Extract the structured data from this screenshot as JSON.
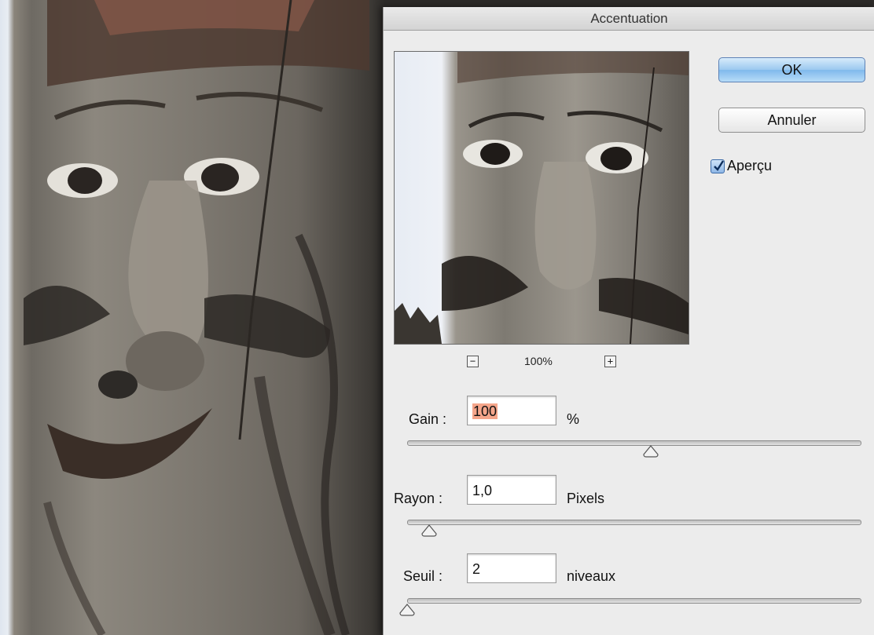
{
  "dialog": {
    "title": "Accentuation",
    "ok_label": "OK",
    "cancel_label": "Annuler",
    "preview_checkbox": {
      "label": "Aperçu",
      "checked": true
    },
    "zoom": {
      "value": "100%",
      "minus_icon": "minus-icon",
      "plus_icon": "plus-icon"
    },
    "fields": [
      {
        "label": "Gain :",
        "value": "100",
        "unit": "%",
        "slider_position": 0.53
      },
      {
        "label": "Rayon :",
        "value": "1,0",
        "unit": "Pixels",
        "slider_position": 0.04
      },
      {
        "label": "Seuil :",
        "value": "2",
        "unit": "niveaux",
        "slider_position": 0.0
      }
    ]
  },
  "colors": {
    "ok_button": "#80b9ec",
    "selection_highlight": "#f5a58a",
    "checkbox": "#8fb7e6"
  }
}
